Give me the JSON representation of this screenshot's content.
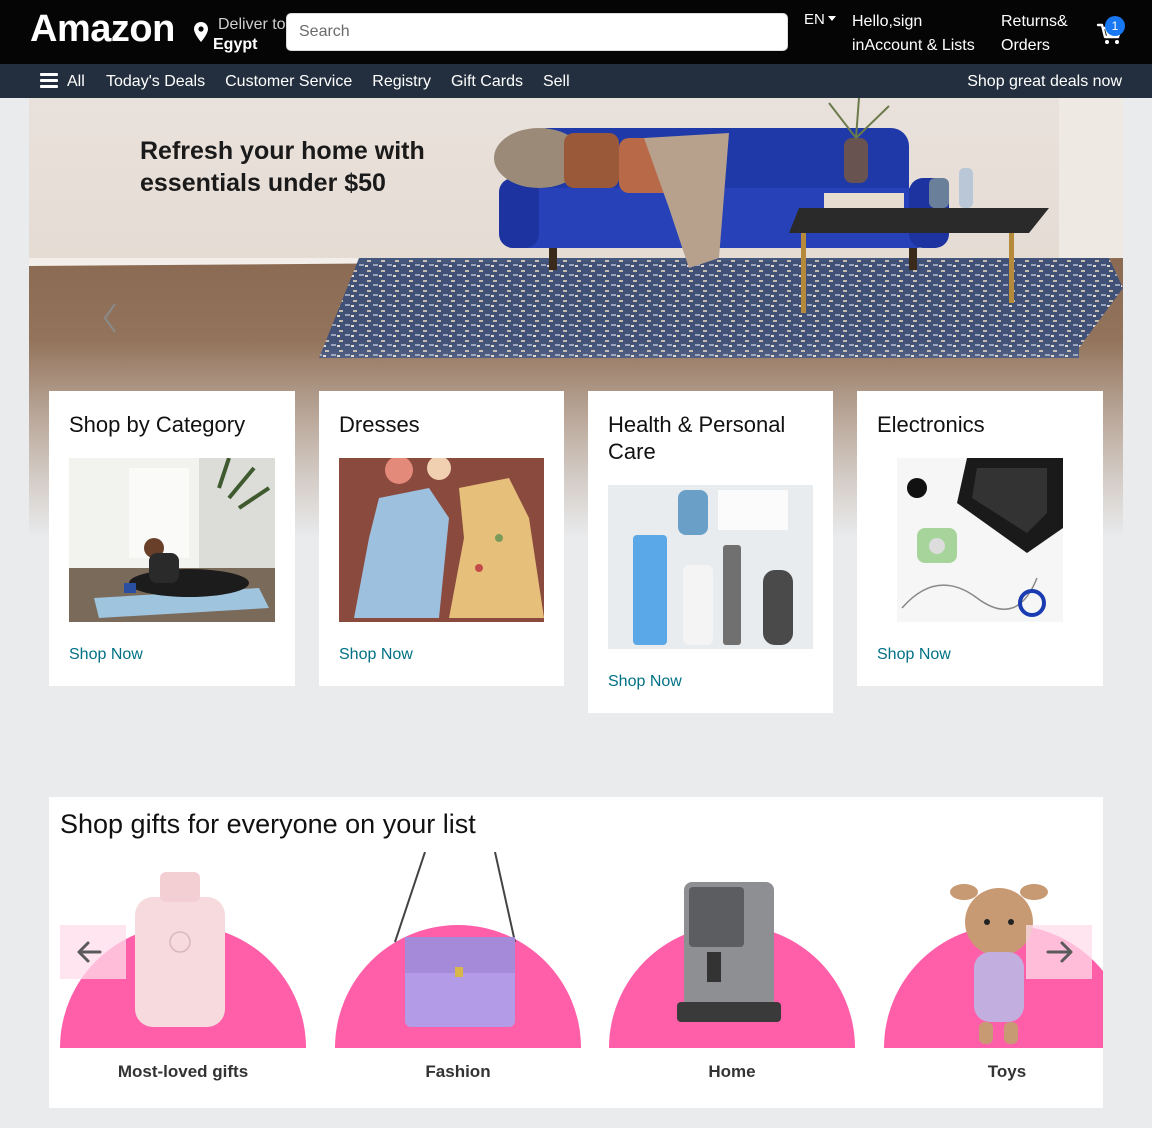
{
  "header": {
    "logo": "Amazon",
    "deliver_label": "Deliver to",
    "deliver_location": "Egypt",
    "search_placeholder": "Search",
    "language": "EN",
    "account_line1": "Hello,sign",
    "account_line2": "inAccount & Lists",
    "returns_line1": "Returns&",
    "returns_line2": "Orders",
    "cart_count": "1"
  },
  "nav": {
    "all_label": "All",
    "links": [
      "Today's Deals",
      "Customer Service",
      "Registry",
      "Gift Cards",
      "Sell"
    ],
    "right_link": "Shop great deals now"
  },
  "hero": {
    "headline": "Refresh your home with essentials under $50"
  },
  "cards": [
    {
      "title": "Shop by Category",
      "link": "Shop Now"
    },
    {
      "title": "Dresses",
      "link": "Shop Now"
    },
    {
      "title": "Health & Personal Care",
      "link": "Shop Now"
    },
    {
      "title": "Electronics",
      "link": "Shop Now"
    }
  ],
  "gifts": {
    "heading": "Shop gifts for everyone on your list",
    "items": [
      {
        "label": "Most-loved gifts"
      },
      {
        "label": "Fashion"
      },
      {
        "label": "Home"
      },
      {
        "label": "Toys"
      }
    ]
  },
  "colors": {
    "header_bg": "#050505",
    "nav_bg": "#232f3e",
    "link": "#007185",
    "gift_pink": "#ff5fa8",
    "badge": "#1877f2"
  }
}
